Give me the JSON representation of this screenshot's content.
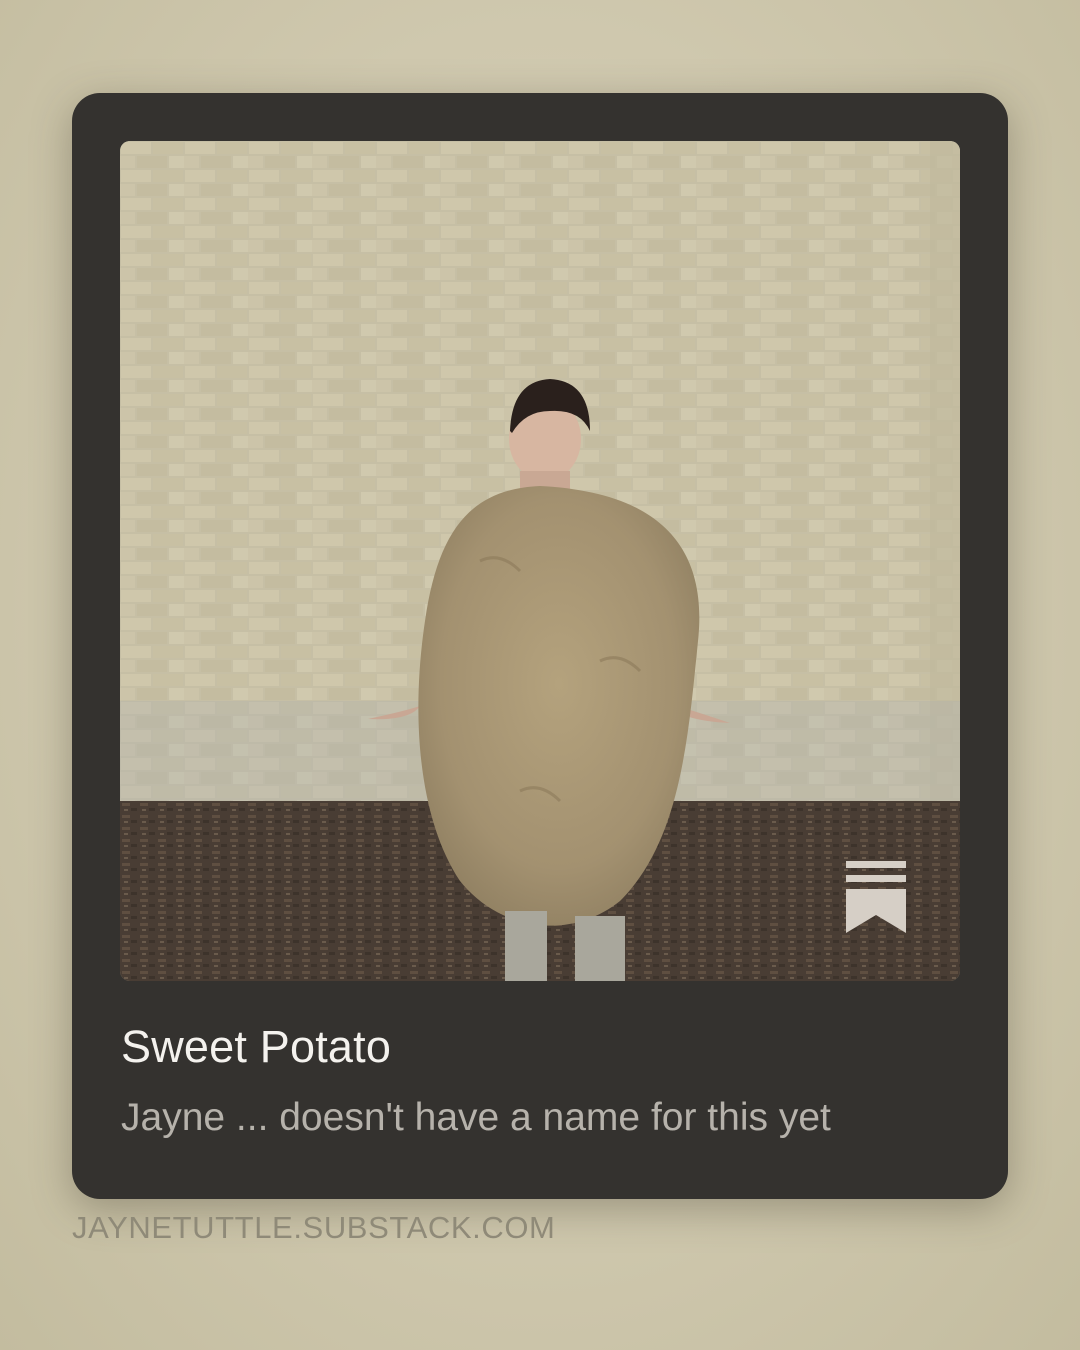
{
  "card": {
    "title": "Sweet Potato",
    "subtitle": "Jayne ... doesn't have a name for this yet",
    "bookmark_icon": "bookmark-icon"
  },
  "footer": {
    "domain": "JAYNETUTTLE.SUBSTACK.COM"
  },
  "colors": {
    "background": "#cfc8ae",
    "card": "#34322f",
    "title": "#f4f2ee",
    "subtitle": "#b6b2ab",
    "domain": "#8f8a78"
  }
}
